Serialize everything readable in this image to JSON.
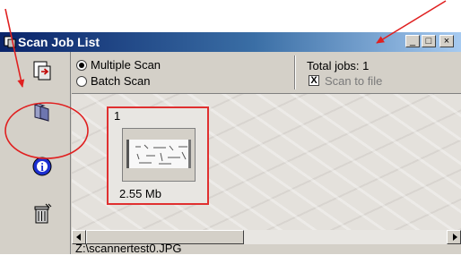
{
  "window": {
    "title": "Scan Job List"
  },
  "title_buttons": {
    "minimize": "_",
    "maximize": "□",
    "close": "×"
  },
  "toolbar": {
    "tools": [
      {
        "icon": "scan-document-icon"
      },
      {
        "icon": "folder-icon"
      },
      {
        "icon": "info-icon",
        "glyph": "i"
      },
      {
        "icon": "trash-icon"
      }
    ]
  },
  "options": {
    "scan_modes": [
      {
        "label": "Multiple Scan",
        "selected": true
      },
      {
        "label": "Batch Scan",
        "selected": false
      }
    ],
    "total_jobs": "Total jobs: 1",
    "scan_to_file": {
      "label": "Scan to file",
      "checked": true,
      "mark": "X"
    }
  },
  "thumbnails": [
    {
      "index": "1",
      "size": "2.55 Mb"
    }
  ],
  "status": {
    "path": "Z:\\scannertest0.JPG"
  },
  "colors": {
    "annotation": "#e02020",
    "title_start": "#0a246a",
    "title_end": "#a6caf0"
  }
}
